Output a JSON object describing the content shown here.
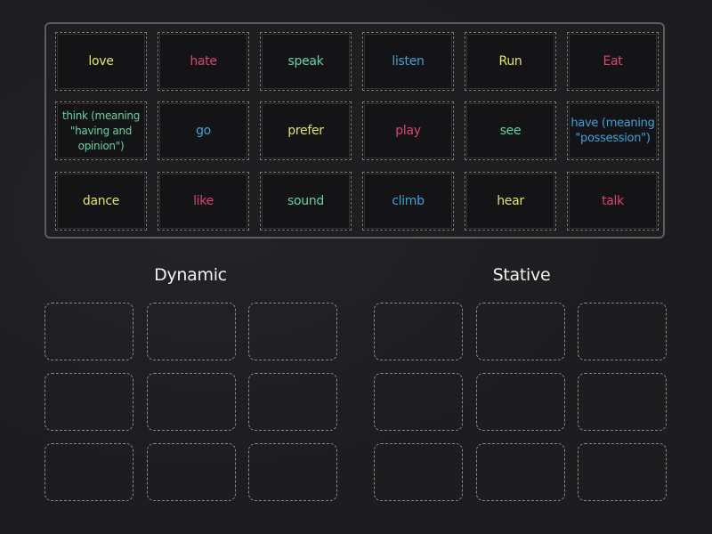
{
  "colors": {
    "background": "#1d1c1f",
    "bank_border": "#5d5d60",
    "yellow": "#e3e65a",
    "pink": "#de4377",
    "teal": "#5fd6a2",
    "blue": "#3aa5d9",
    "title": "#f2f2f2"
  },
  "cards": [
    {
      "label": "love",
      "color": "yellow"
    },
    {
      "label": "hate",
      "color": "pink"
    },
    {
      "label": "speak",
      "color": "teal"
    },
    {
      "label": "listen",
      "color": "blue"
    },
    {
      "label": "Run",
      "color": "yellow"
    },
    {
      "label": "Eat",
      "color": "pink"
    },
    {
      "label": "think (meaning \"having and opinion\")",
      "color": "teal"
    },
    {
      "label": "go",
      "color": "blue"
    },
    {
      "label": "prefer",
      "color": "yellow"
    },
    {
      "label": "play",
      "color": "pink"
    },
    {
      "label": "see",
      "color": "teal"
    },
    {
      "label": "have (meaning \"possession\")",
      "color": "blue"
    },
    {
      "label": "dance",
      "color": "yellow"
    },
    {
      "label": "like",
      "color": "pink"
    },
    {
      "label": "sound",
      "color": "teal"
    },
    {
      "label": "climb",
      "color": "blue"
    },
    {
      "label": "hear",
      "color": "yellow"
    },
    {
      "label": "talk",
      "color": "pink"
    }
  ],
  "groups": [
    {
      "title": "Dynamic",
      "slot_count": 9
    },
    {
      "title": "Stative",
      "slot_count": 9
    }
  ]
}
